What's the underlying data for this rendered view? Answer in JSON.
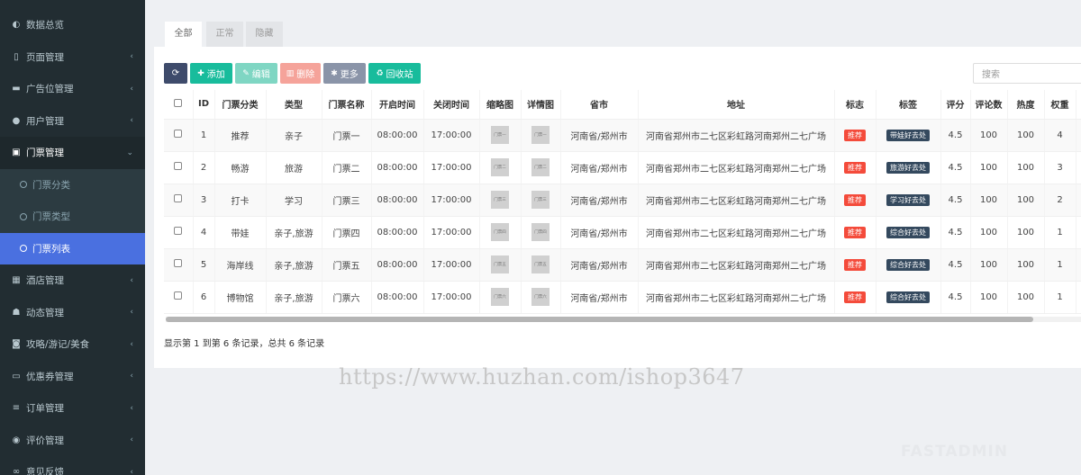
{
  "sidebar": {
    "items": [
      {
        "label": "数据总览",
        "icon": "dashboard-icon",
        "glyph": "◐"
      },
      {
        "label": "页面管理",
        "icon": "bookmark-icon",
        "glyph": "▯"
      },
      {
        "label": "广告位管理",
        "icon": "credit-card-icon",
        "glyph": "▬"
      },
      {
        "label": "用户管理",
        "icon": "user-icon",
        "glyph": "●"
      },
      {
        "label": "门票管理",
        "icon": "ticket-icon",
        "glyph": "▣"
      },
      {
        "label": "酒店管理",
        "icon": "building-icon",
        "glyph": "▦"
      },
      {
        "label": "动态管理",
        "icon": "walking-icon",
        "glyph": "☗"
      },
      {
        "label": "攻略/游记/美食",
        "icon": "camera-icon",
        "glyph": "◙"
      },
      {
        "label": "优惠券管理",
        "icon": "coupon-icon",
        "glyph": "▭"
      },
      {
        "label": "订单管理",
        "icon": "list-icon",
        "glyph": "≡"
      },
      {
        "label": "评价管理",
        "icon": "gamepad-icon",
        "glyph": "◉"
      },
      {
        "label": "意见反馈",
        "icon": "link-icon",
        "glyph": "∞"
      }
    ],
    "sub_items": [
      "门票分类",
      "门票类型",
      "门票列表"
    ]
  },
  "tabs": [
    "全部",
    "正常",
    "隐藏"
  ],
  "toolbar": {
    "refresh_glyph": "⟳",
    "add": "添加",
    "edit": "编辑",
    "delete": "删除",
    "more": "更多",
    "recycle": "回收站",
    "colors": {
      "refresh": "#3e4b6b",
      "add": "#18bc9c",
      "edit": "#7fd6c3",
      "delete": "#f5a39a",
      "more": "#8a94a8",
      "recycle": "#18bc9c"
    }
  },
  "search": {
    "placeholder": "搜索"
  },
  "table": {
    "headers": [
      "ID",
      "门票分类",
      "类型",
      "门票名称",
      "开启时间",
      "关闭时间",
      "缩略图",
      "详情图",
      "省市",
      "地址",
      "标志",
      "标签",
      "评分",
      "评论数",
      "热度",
      "权重"
    ],
    "rows": [
      {
        "id": "1",
        "category": "推荐",
        "type": "亲子",
        "name": "门票一",
        "open": "08:00:00",
        "close": "17:00:00",
        "thumb": "门票一",
        "detail": "门票一",
        "region": "河南省/郑州市",
        "address": "河南省郑州市二七区彩虹路河南郑州二七广场",
        "flag": "推荐",
        "tag": "带娃好去处",
        "score": "4.5",
        "comments": "100",
        "heat": "100",
        "weight": "4"
      },
      {
        "id": "2",
        "category": "畅游",
        "type": "旅游",
        "name": "门票二",
        "open": "08:00:00",
        "close": "17:00:00",
        "thumb": "门票二",
        "detail": "门票二",
        "region": "河南省/郑州市",
        "address": "河南省郑州市二七区彩虹路河南郑州二七广场",
        "flag": "推荐",
        "tag": "旅游好去处",
        "score": "4.5",
        "comments": "100",
        "heat": "100",
        "weight": "3"
      },
      {
        "id": "3",
        "category": "打卡",
        "type": "学习",
        "name": "门票三",
        "open": "08:00:00",
        "close": "17:00:00",
        "thumb": "门票三",
        "detail": "门票三",
        "region": "河南省/郑州市",
        "address": "河南省郑州市二七区彩虹路河南郑州二七广场",
        "flag": "推荐",
        "tag": "学习好去处",
        "score": "4.5",
        "comments": "100",
        "heat": "100",
        "weight": "2"
      },
      {
        "id": "4",
        "category": "带娃",
        "type": "亲子,旅游",
        "name": "门票四",
        "open": "08:00:00",
        "close": "17:00:00",
        "thumb": "门票四",
        "detail": "门票四",
        "region": "河南省/郑州市",
        "address": "河南省郑州市二七区彩虹路河南郑州二七广场",
        "flag": "推荐",
        "tag": "综合好去处",
        "score": "4.5",
        "comments": "100",
        "heat": "100",
        "weight": "1"
      },
      {
        "id": "5",
        "category": "海岸线",
        "type": "亲子,旅游",
        "name": "门票五",
        "open": "08:00:00",
        "close": "17:00:00",
        "thumb": "门票五",
        "detail": "门票五",
        "region": "河南省/郑州市",
        "address": "河南省郑州市二七区彩虹路河南郑州二七广场",
        "flag": "推荐",
        "tag": "综合好去处",
        "score": "4.5",
        "comments": "100",
        "heat": "100",
        "weight": "1"
      },
      {
        "id": "6",
        "category": "博物馆",
        "type": "亲子,旅游",
        "name": "门票六",
        "open": "08:00:00",
        "close": "17:00:00",
        "thumb": "门票六",
        "detail": "门票六",
        "region": "河南省/郑州市",
        "address": "河南省郑州市二七区彩虹路河南郑州二七广场",
        "flag": "推荐",
        "tag": "综合好去处",
        "score": "4.5",
        "comments": "100",
        "heat": "100",
        "weight": "1"
      }
    ]
  },
  "pager": {
    "info": "显示第 1 到第 6 条记录，总共 6 条记录"
  },
  "watermark": "https://www.huzhan.com/ishop3647",
  "brand": "FASTADMIN"
}
